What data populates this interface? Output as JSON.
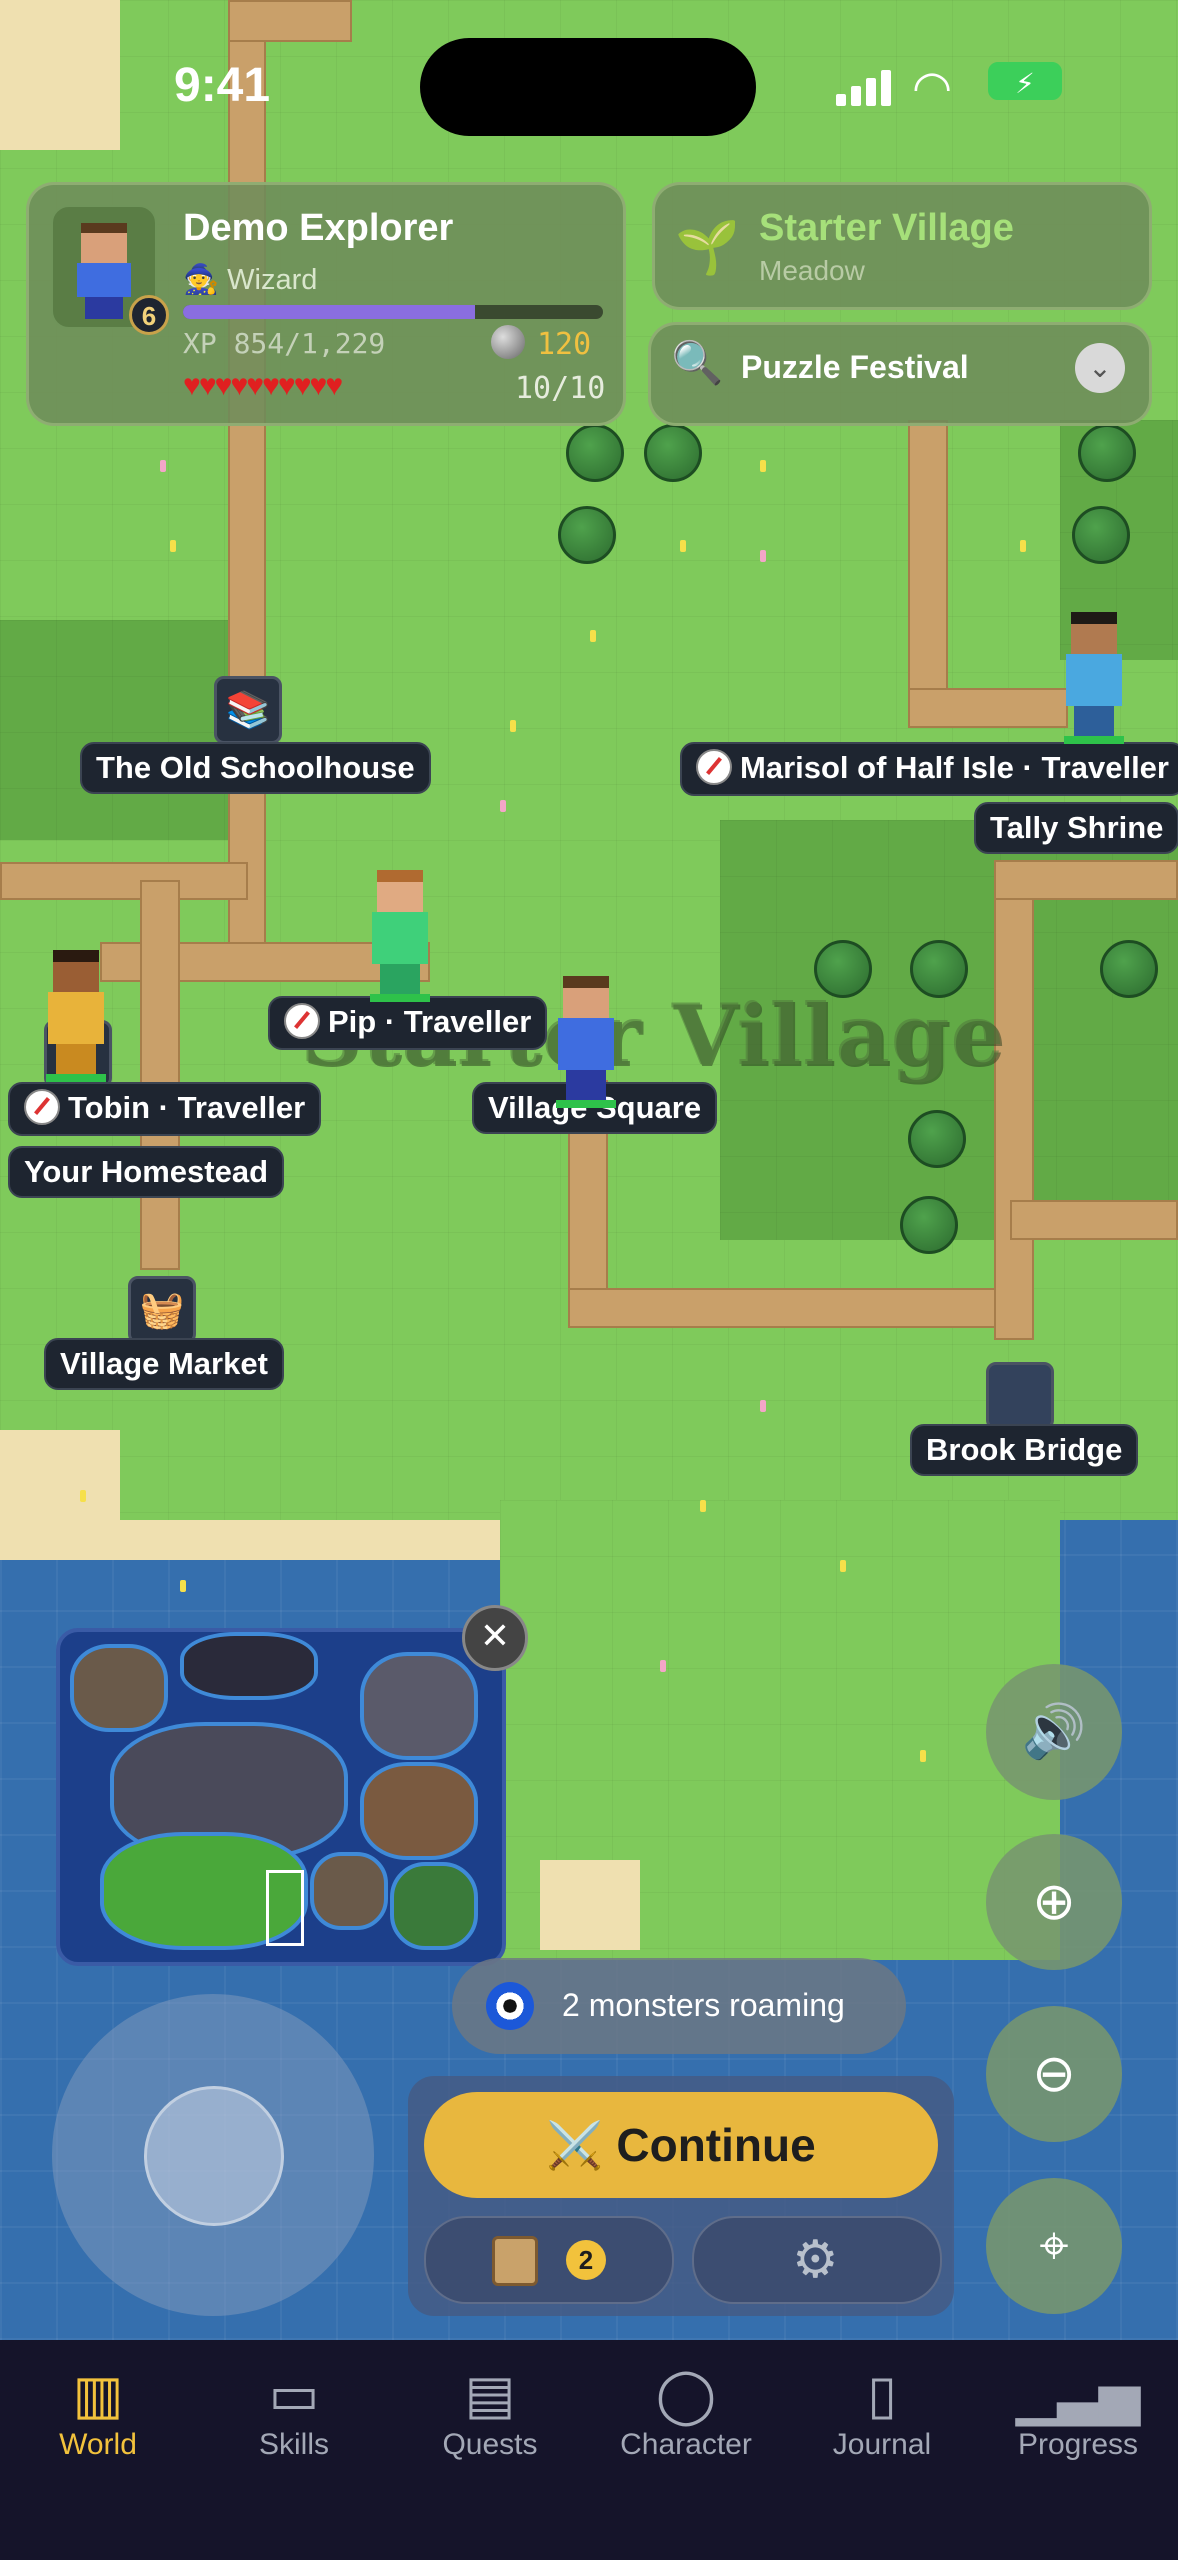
{
  "status_bar": {
    "time": "9:41"
  },
  "player": {
    "name": "Demo Explorer",
    "class": "Wizard",
    "level": "6",
    "xp_text": "XP 854/1,229",
    "xp_fraction": 0.695,
    "gold": "120",
    "hp_text": "10/10",
    "hearts": "♥♥♥♥♥♥♥♥♥♥"
  },
  "region": {
    "name": "Starter Village",
    "biome": "Meadow"
  },
  "event_selector": {
    "label": "Puzzle Festival"
  },
  "map": {
    "title": "Starter Village",
    "locations": [
      "The Old Schoolhouse",
      "Tally Shrine",
      "Village Square",
      "Your Homestead",
      "Village Market",
      "Brook Bridge"
    ],
    "travellers": [
      "Marisol of Half Isle · Traveller",
      "Pip · Traveller",
      "Tobin · Traveller"
    ]
  },
  "monsters": {
    "text": "2 monsters roaming"
  },
  "actions": {
    "continue_label": "Continue",
    "quest_count": "2"
  },
  "tabs": [
    {
      "label": "World",
      "icon": "map-icon"
    },
    {
      "label": "Skills",
      "icon": "book-icon"
    },
    {
      "label": "Quests",
      "icon": "scroll-icon"
    },
    {
      "label": "Character",
      "icon": "person-icon"
    },
    {
      "label": "Journal",
      "icon": "journal-icon"
    },
    {
      "label": "Progress",
      "icon": "bar-chart-icon"
    }
  ],
  "colors": {
    "accent": "#f2c23c",
    "tabbar": "#15142a",
    "grass": "#7fca5b",
    "xp": "#8a6ee0"
  }
}
